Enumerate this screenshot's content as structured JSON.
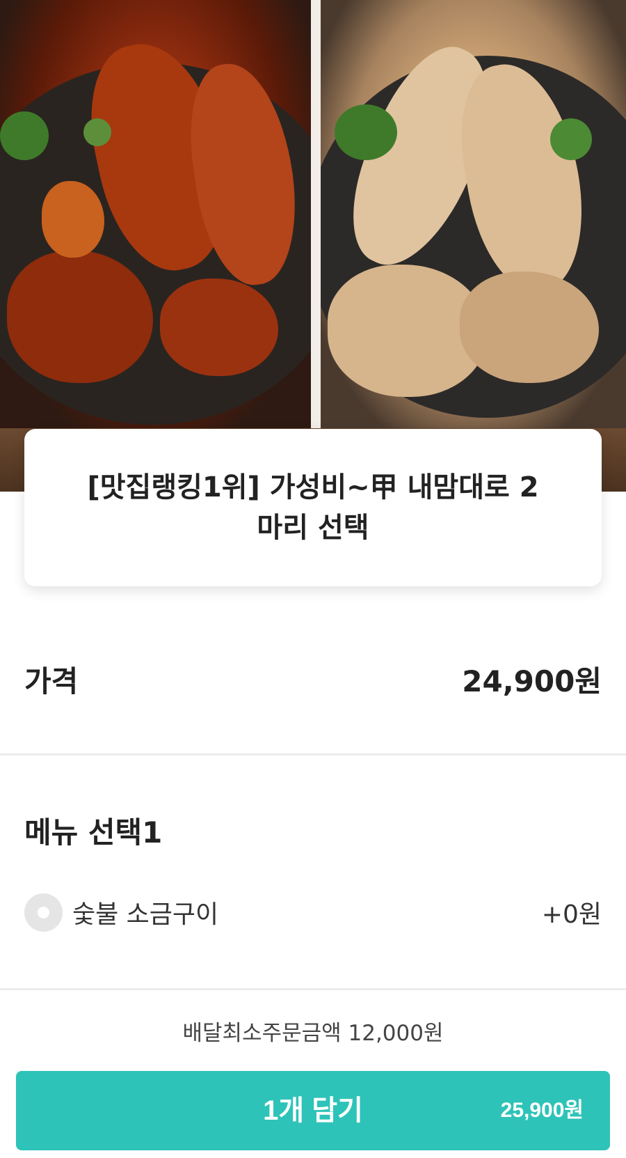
{
  "product": {
    "title": "[맛집랭킹1위] 가성비~甲 내맘대로 2 마리 선택"
  },
  "price": {
    "label": "가격",
    "value": "24,900원"
  },
  "menu_section": {
    "title": "메뉴 선택1",
    "options": [
      {
        "label": "숯불 소금구이",
        "price": "+0원",
        "selected": false
      }
    ]
  },
  "footer": {
    "min_order": "배달최소주문금액 12,000원",
    "cart_button_label": "1개 담기",
    "cart_button_price": "25,900원"
  },
  "colors": {
    "accent": "#2ec3b8",
    "radio_unselected": "#e5e5e5"
  }
}
